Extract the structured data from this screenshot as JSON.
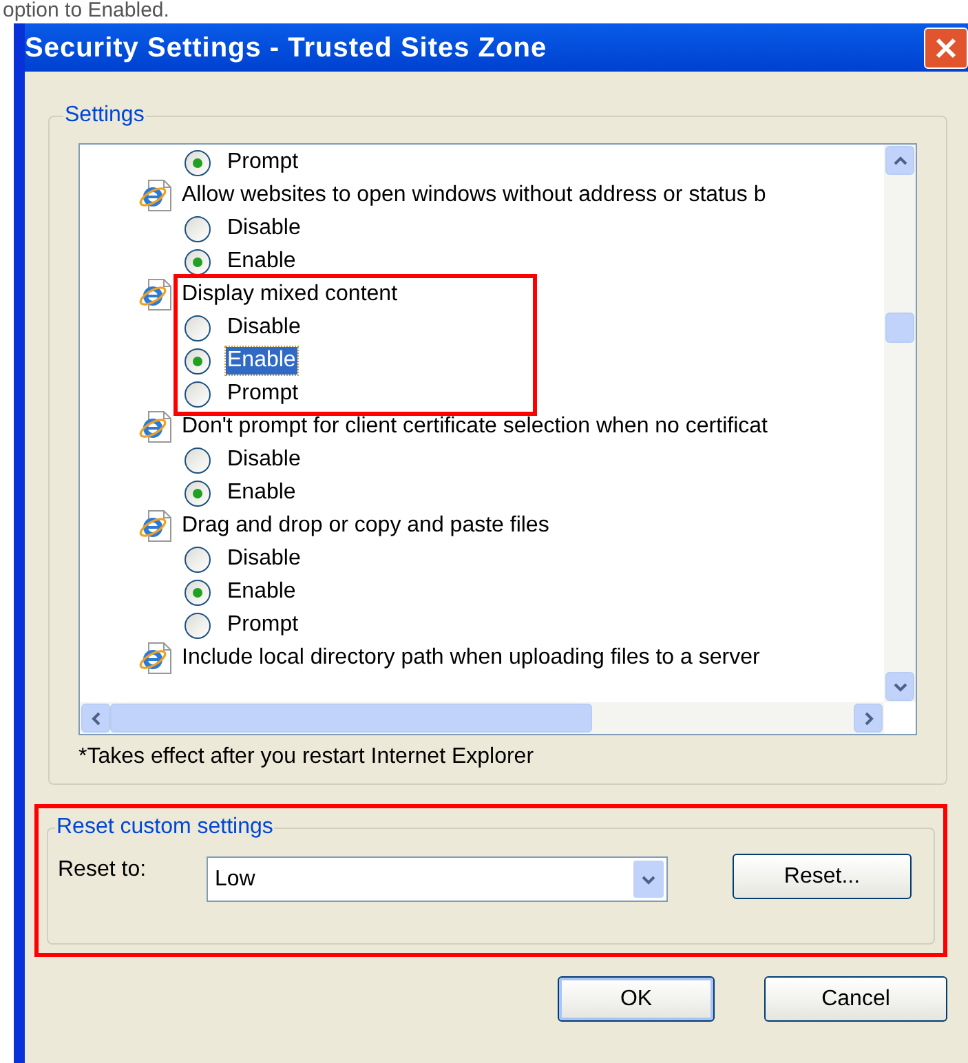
{
  "caption": "option to Enabled.",
  "window": {
    "title": "Security Settings - Trusted Sites Zone"
  },
  "settings_group": {
    "label": "Settings",
    "entries": [
      {
        "kind": "options",
        "highlighted": false,
        "options": [
          {
            "label": "Prompt",
            "selected": true,
            "focused": false
          }
        ]
      },
      {
        "kind": "setting",
        "heading": "Allow websites to open windows without address or status b",
        "highlighted": false,
        "options": [
          {
            "label": "Disable",
            "selected": false,
            "focused": false
          },
          {
            "label": "Enable",
            "selected": true,
            "focused": false
          }
        ]
      },
      {
        "kind": "setting",
        "heading": "Display mixed content",
        "highlighted": true,
        "options": [
          {
            "label": "Disable",
            "selected": false,
            "focused": false
          },
          {
            "label": "Enable",
            "selected": true,
            "focused": true
          },
          {
            "label": "Prompt",
            "selected": false,
            "focused": false
          }
        ]
      },
      {
        "kind": "setting",
        "heading": "Don't prompt for client certificate selection when no certificat",
        "highlighted": false,
        "options": [
          {
            "label": "Disable",
            "selected": false,
            "focused": false
          },
          {
            "label": "Enable",
            "selected": true,
            "focused": false
          }
        ]
      },
      {
        "kind": "setting",
        "heading": "Drag and drop or copy and paste files",
        "highlighted": false,
        "options": [
          {
            "label": "Disable",
            "selected": false,
            "focused": false
          },
          {
            "label": "Enable",
            "selected": true,
            "focused": false
          },
          {
            "label": "Prompt",
            "selected": false,
            "focused": false
          }
        ]
      },
      {
        "kind": "setting",
        "heading": "Include local directory path when uploading files to a server",
        "highlighted": false
      }
    ],
    "note": "*Takes effect after you restart Internet Explorer"
  },
  "reset_group": {
    "label": "Reset custom settings",
    "highlighted": true,
    "reset_to_label": "Reset to:",
    "reset_to_value": "Low",
    "reset_button": "Reset..."
  },
  "buttons": [
    "OK",
    "Cancel"
  ]
}
